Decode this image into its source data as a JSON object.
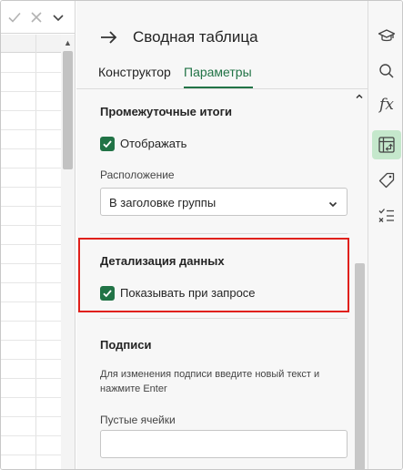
{
  "formula_bar": {
    "accept_icon": "checkmark-icon",
    "cancel_icon": "close-icon",
    "expand_icon": "chevron-down-icon"
  },
  "pane": {
    "back_icon": "arrow-right-icon",
    "title": "Сводная таблица",
    "tabs": [
      {
        "label": "Конструктор",
        "active": false
      },
      {
        "label": "Параметры",
        "active": true
      }
    ],
    "subtotals": {
      "heading": "Промежуточные итоги",
      "show_checkbox": {
        "label": "Отображать",
        "checked": true
      },
      "location_label": "Расположение",
      "location_value": "В заголовке группы"
    },
    "drilldown": {
      "heading": "Детализация данных",
      "show_on_request": {
        "label": "Показывать при запросе",
        "checked": true
      }
    },
    "captions": {
      "heading": "Подписи",
      "hint": "Для изменения подписи введите новый текст и нажмите Enter",
      "empty_cells_label": "Пустые ячейки",
      "empty_cells_value": ""
    }
  },
  "rail": {
    "items": [
      {
        "icon": "graduation-cap-icon",
        "active": false
      },
      {
        "icon": "search-icon",
        "active": false
      },
      {
        "icon": "function-icon",
        "glyph": "fx",
        "active": false
      },
      {
        "icon": "pivot-table-icon",
        "active": true
      },
      {
        "icon": "tag-icon",
        "active": false
      },
      {
        "icon": "checklist-icon",
        "active": false
      }
    ]
  },
  "colors": {
    "accent": "#217346",
    "highlight": "#e0201b",
    "active_rail_bg": "#c5e8cc"
  }
}
